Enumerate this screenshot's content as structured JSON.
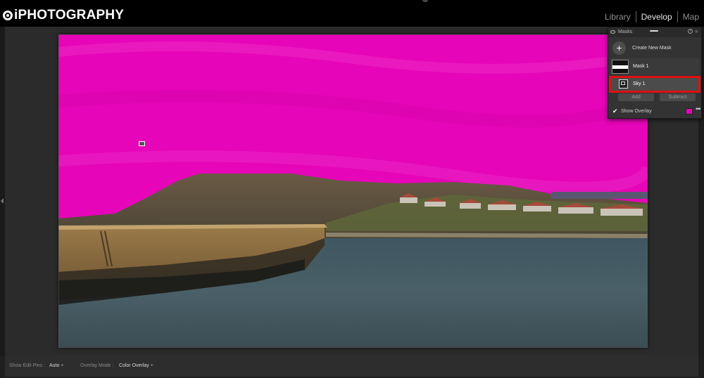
{
  "brand": {
    "name": "iPHOTOGRAPHY"
  },
  "modules": [
    "Library",
    "Develop",
    "Map"
  ],
  "active_module": "Develop",
  "masks_panel": {
    "title": "Masks",
    "help": "?",
    "collapse": "»",
    "create_label": "Create New Mask",
    "create_icon": "+",
    "mask_name": "Mask 1",
    "component_name": "Sky 1",
    "add_label": "Add",
    "subtract_label": "Subtract",
    "show_overlay_label": "Show Overlay",
    "show_overlay_checked": true,
    "overlay_color": "#e605b8",
    "more": "•••"
  },
  "toolbar": {
    "show_edit_pins_label": "Show Edit Pins :",
    "show_edit_pins_value": "Auto ÷",
    "overlay_mode_label": "Overlay Mode :",
    "overlay_mode_value": "Color Overlay ÷"
  },
  "colors": {
    "overlay_magenta": "#e605b8",
    "highlight_red": "#e01010",
    "background": "#2b2b2b"
  }
}
